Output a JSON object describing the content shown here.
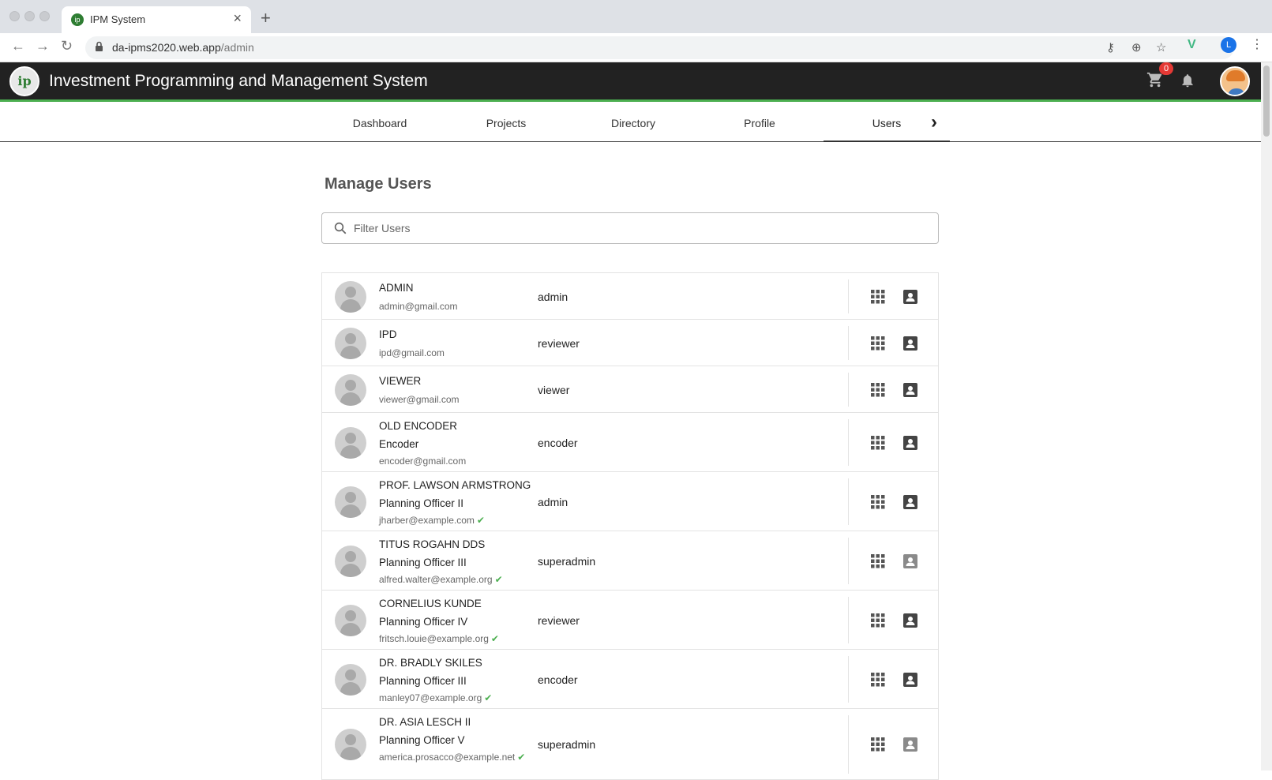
{
  "browser": {
    "tab_title": "IPM System",
    "url_host": "da-ipms2020.web.app",
    "url_path": "/admin",
    "profile_letter": "L"
  },
  "header": {
    "title": "Investment Programming and Management System",
    "logo_text": "ip",
    "cart_count": "0"
  },
  "nav": {
    "tabs": [
      {
        "label": "Dashboard"
      },
      {
        "label": "Projects"
      },
      {
        "label": "Directory"
      },
      {
        "label": "Profile"
      },
      {
        "label": "Users",
        "active": true
      }
    ]
  },
  "main": {
    "title": "Manage Users",
    "filter_placeholder": "Filter Users"
  },
  "users": [
    {
      "name": "ADMIN",
      "position": "",
      "email": "admin@gmail.com",
      "role": "admin",
      "verified": false
    },
    {
      "name": "IPD",
      "position": "",
      "email": "ipd@gmail.com",
      "role": "reviewer",
      "verified": false
    },
    {
      "name": "VIEWER",
      "position": "",
      "email": "viewer@gmail.com",
      "role": "viewer",
      "verified": false
    },
    {
      "name": "OLD ENCODER",
      "position": "Encoder",
      "email": "encoder@gmail.com",
      "role": "encoder",
      "verified": false
    },
    {
      "name": "PROF. LAWSON ARMSTRONG",
      "position": "Planning Officer II",
      "email": "jharber@example.com",
      "role": "admin",
      "verified": true
    },
    {
      "name": "TITUS ROGAHN DDS",
      "position": "Planning Officer III",
      "email": "alfred.walter@example.org",
      "role": "superadmin",
      "verified": true
    },
    {
      "name": "CORNELIUS KUNDE",
      "position": "Planning Officer IV",
      "email": "fritsch.louie@example.org",
      "role": "reviewer",
      "verified": true
    },
    {
      "name": "DR. BRADLY SKILES",
      "position": "Planning Officer III",
      "email": "manley07@example.org",
      "role": "encoder",
      "verified": true
    },
    {
      "name": "DR. ASIA LESCH II",
      "position": "Planning Officer V",
      "email": "america.prosacco@example.net",
      "role": "superadmin",
      "verified": true
    }
  ],
  "colors": {
    "header_bg": "#222222",
    "accent": "#4caf50",
    "badge": "#e53935"
  }
}
